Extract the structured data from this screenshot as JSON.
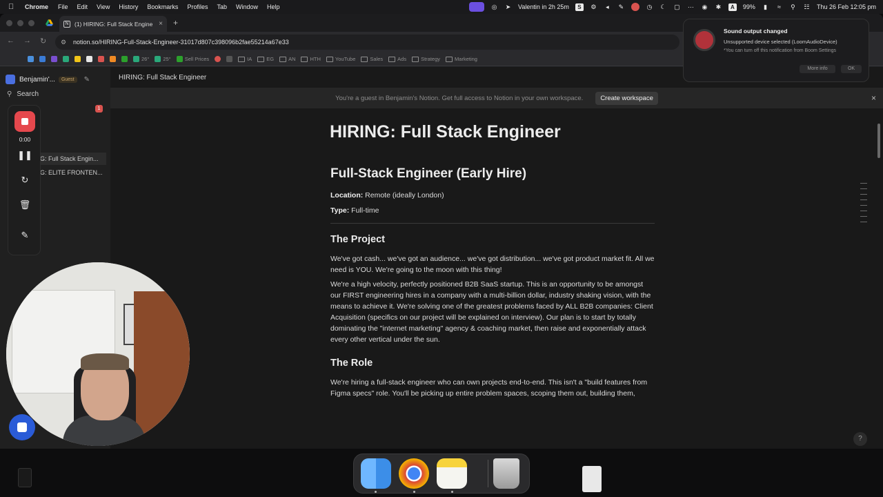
{
  "menubar": {
    "app_name": "Chrome",
    "menus": [
      "File",
      "Edit",
      "View",
      "History",
      "Bookmarks",
      "Profiles",
      "Tab",
      "Window",
      "Help"
    ],
    "calendar_text": "Valentin in 2h 25m",
    "battery": "99%",
    "datetime": "Thu 26 Feb  12:05 pm"
  },
  "browser": {
    "tab_title": "(1) HIRING: Full Stack Engine",
    "url": "notion.so/HIRING-Full-Stack-Engineer-31017d807c398096b2fae55214a67e33",
    "bookmarks": [
      "26°",
      "25°",
      "Sell Prices",
      "IA",
      "EG",
      "AN",
      "HTH",
      "YouTube",
      "Sales",
      "Ads",
      "Strategy",
      "Marketing"
    ]
  },
  "notion": {
    "workspace_name": "Benjamin'...",
    "guest_badge": "Guest",
    "search_label": "Search",
    "notif_count": "1",
    "sidebar_pages": [
      "G: Full Stack Engin...",
      "G: ELITE FRONTEN..."
    ],
    "breadcrumb": "HIRING: Full Stack Engineer",
    "guest_banner": "You're a guest in Benjamin's Notion. Get full access to Notion in your own workspace.",
    "create_workspace": "Create workspace",
    "help": "?"
  },
  "page": {
    "title": "HIRING: Full Stack Engineer",
    "role_heading": "Full-Stack Engineer (Early Hire)",
    "location_label": "Location:",
    "location_value": "Remote (ideally London)",
    "type_label": "Type:",
    "type_value": "Full-time",
    "project_heading": "The Project",
    "project_p1": "We've got cash... we've got an audience... we've got distribution... we've got product market fit. All we need is YOU. We're going to the moon with this thing!",
    "project_p2": "We're a high velocity, perfectly positioned B2B SaaS startup. This is an opportunity to be amongst our FIRST engineering hires in a company with a multi-billion dollar, industry shaking vision, with the means to achieve it. We're solving one of the greatest problems faced by ALL B2B companies: Client Acquisition (specifics on our project will be explained on interview). Our plan is to start by totally dominating the \"internet marketing\" agency & coaching market, then raise and exponentially attack every other vertical under the sun.",
    "role_section_heading": "The Role",
    "role_p1": "We're hiring a full-stack engineer who can own projects end-to-end. This isn't a \"build features from Figma specs\" role. You'll be picking up entire problem spaces, scoping them out, building them, deploying them as microservices, and iterating based on what you learn."
  },
  "loom": {
    "timer": "0:00"
  },
  "notification": {
    "title": "Sound output changed",
    "body": "Unsupported device selected (LoomAudioDevice)",
    "hint": "*You can turn off this notification from Boom Settings",
    "more_info": "More info",
    "ok": "OK"
  },
  "colors": {
    "loom_red": "#e5484d",
    "notion_bg": "#191919",
    "loom_blue": "#2a5bd7"
  }
}
